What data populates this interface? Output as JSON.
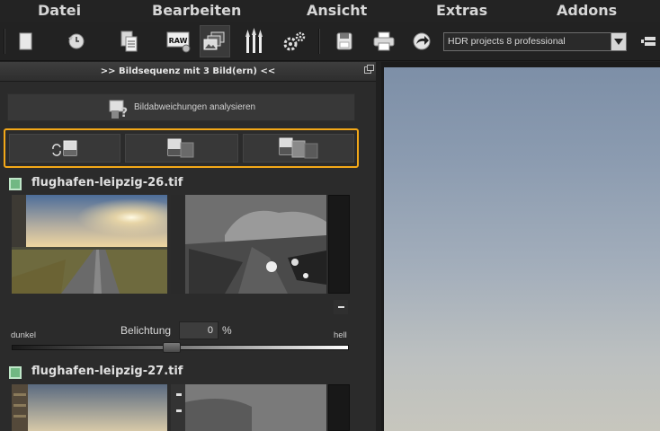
{
  "menu": {
    "items": [
      "Datei",
      "Bearbeiten",
      "Ansicht",
      "Extras",
      "Addons"
    ]
  },
  "toolbar": {
    "buttons": [
      {
        "name": "new-icon"
      },
      {
        "name": "history-icon"
      },
      {
        "name": "copy-document-icon"
      },
      {
        "name": "raw-icon",
        "label": "RAW"
      },
      {
        "name": "image-sequence-icon",
        "active": true
      },
      {
        "name": "brushes-icon"
      },
      {
        "name": "settings-gears-icon"
      },
      {
        "name": "save-icon"
      },
      {
        "name": "print-icon"
      },
      {
        "name": "export-arrow-icon"
      }
    ],
    "preset": {
      "value": "HDR projects 8 professional"
    }
  },
  "panel": {
    "title": ">> Bildsequenz mit 3 Bild(ern) <<",
    "analyze_label": "Bildabweichungen analysieren",
    "view_buttons": [
      "swap-view-icon",
      "two-image-view-icon",
      "three-image-view-icon"
    ],
    "images": [
      {
        "filename": "flughafen-leipzig-26.tif",
        "checked": true,
        "exposure": {
          "label": "Belichtung",
          "value": "0",
          "unit": "%",
          "min_label": "dunkel",
          "max_label": "hell",
          "position": 0.5
        }
      },
      {
        "filename": "flughafen-leipzig-27.tif",
        "checked": true
      }
    ]
  },
  "colors": {
    "accent_highlight": "#f3a818",
    "checkbox_green": "#71b883"
  }
}
